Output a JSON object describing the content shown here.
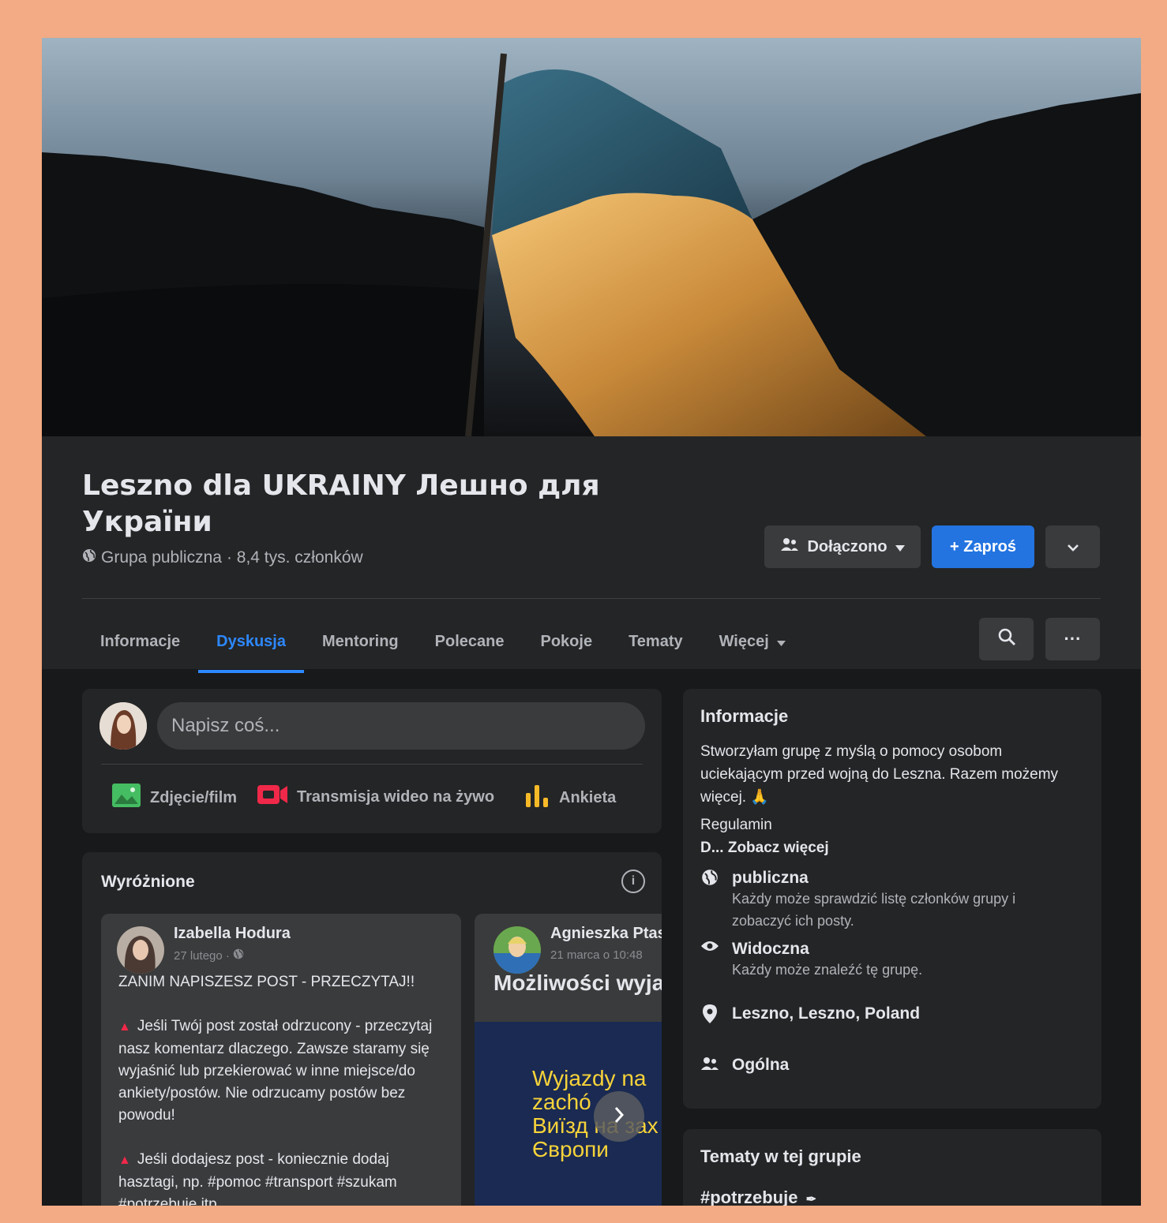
{
  "group": {
    "title": "Leszno dla UKRAINY Лешно для України",
    "privacy": "Grupa publiczna",
    "members": "· 8,4 tys. członków"
  },
  "actions": {
    "joined_label": "Dołączono",
    "invite_label": "+ Zaproś"
  },
  "tabs": [
    {
      "label": "Informacje"
    },
    {
      "label": "Dyskusja",
      "active": true
    },
    {
      "label": "Mentoring"
    },
    {
      "label": "Polecane"
    },
    {
      "label": "Pokoje"
    },
    {
      "label": "Tematy"
    },
    {
      "label": "Więcej"
    }
  ],
  "composer": {
    "placeholder": "Napisz coś...",
    "photo_label": "Zdjęcie/film",
    "live_label": "Transmisja wideo na żywo",
    "poll_label": "Ankieta"
  },
  "featured": {
    "title": "Wyróżnione",
    "post1": {
      "author": "Izabella Hodura",
      "date": "27 lutego ·",
      "heading": "ZANIM NAPISZESZ POST - PRZECZYTAJ!!",
      "para1": "Jeśli Twój post został odrzucony - przeczytaj nasz komentarz dlaczego. Zawsze staramy się wyjaśnić lub przekierować w inne miejsce/do ankiety/postów. Nie odrzucamy postów bez powodu!",
      "para2": "Jeśli dodajesz post - koniecznie dodaj hasztagi, np. #pomoc #transport #szukam #potrzebuje itp."
    },
    "post2": {
      "author": "Agnieszka Ptas",
      "date": "21 marca o 10:48",
      "heading": "Możliwości wyja",
      "image_line1": "Wyjazdy na",
      "image_line2": "zachó",
      "image_line3": "Виїзд на зах",
      "image_line4": "Європи"
    }
  },
  "about": {
    "title": "Informacje",
    "description": "Stworzyłam grupę z myślą o pomocy osobom uciekającym przed wojną do Leszna. Razem możemy więcej. 🙏",
    "rules": "Regulamin",
    "see_more": "D... Zobacz więcej",
    "public_title": "publiczna",
    "public_desc": "Każdy może sprawdzić listę członków grupy i zobaczyć ich posty.",
    "visible_title": "Widoczna",
    "visible_desc": "Każdy może znaleźć tę grupę.",
    "location": "Leszno, Leszno, Poland",
    "category": "Ogólna"
  },
  "topics": {
    "title": "Tematy w tej grupie",
    "first": "#potrzebuje"
  },
  "colors": {
    "accent": "#2d88ff",
    "invite_button": "#2374e1",
    "page_frame": "#f2ab84",
    "background": "#18191a",
    "card": "#242526"
  }
}
